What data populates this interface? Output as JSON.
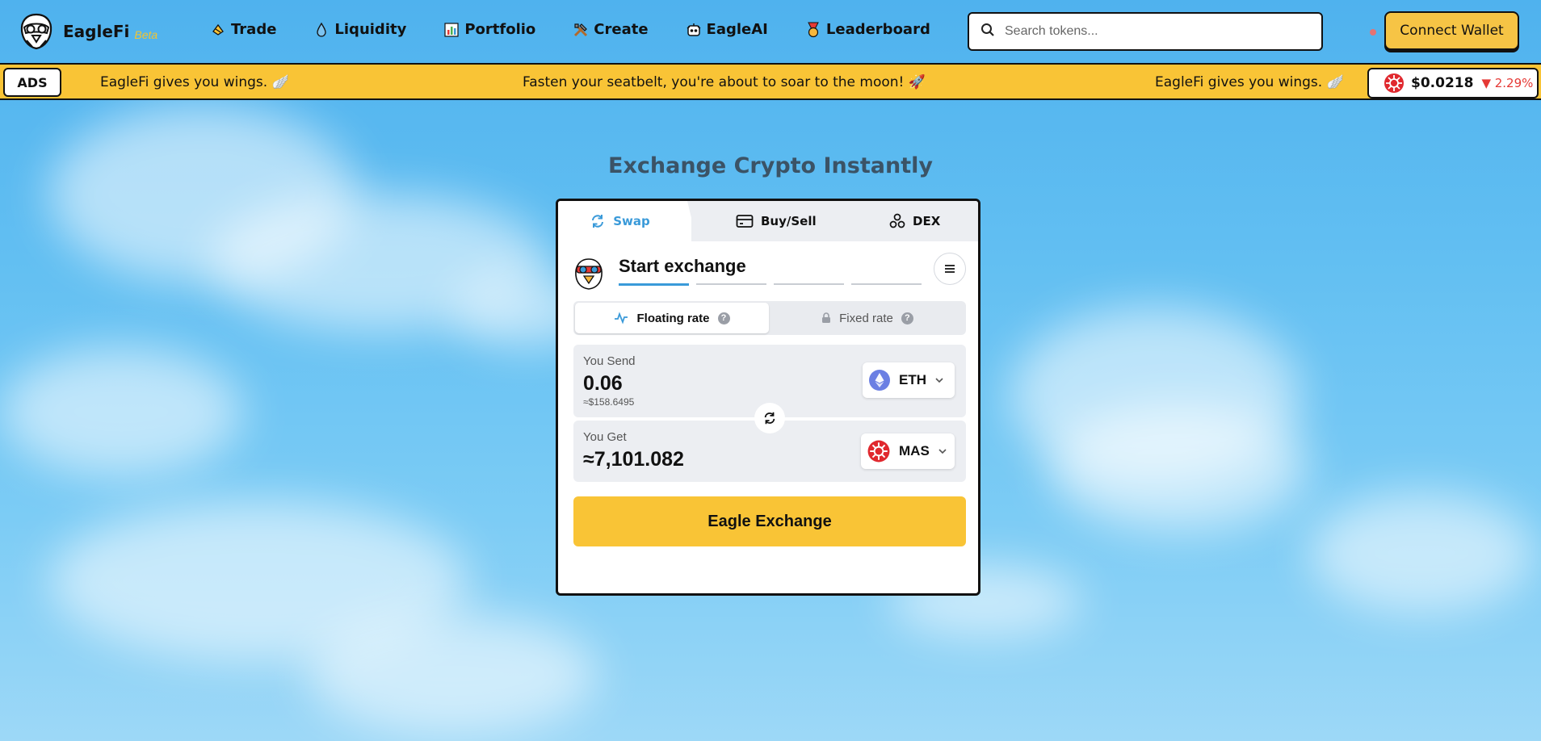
{
  "brand": {
    "name": "EagleFi",
    "beta": "Beta"
  },
  "nav": [
    {
      "label": "Trade",
      "icon": "trade-icon"
    },
    {
      "label": "Liquidity",
      "icon": "droplet-icon"
    },
    {
      "label": "Portfolio",
      "icon": "bar-chart-icon"
    },
    {
      "label": "Create",
      "icon": "tools-icon"
    },
    {
      "label": "EagleAI",
      "icon": "robot-icon"
    },
    {
      "label": "Leaderboard",
      "icon": "medal-icon"
    }
  ],
  "search": {
    "placeholder": "Search tokens..."
  },
  "connect_wallet": "Connect Wallet",
  "ticker": {
    "ads": "ADS",
    "messages": [
      "EagleFi gives you wings. 🪽",
      "Fasten your seatbelt, you're about to soar to the moon! 🚀",
      "EagleFi gives you wings. 🪽"
    ],
    "price": "$0.0218",
    "change": "▼ 2.29%"
  },
  "main": {
    "title": "Exchange Crypto Instantly"
  },
  "tabs": {
    "swap": "Swap",
    "buy_sell": "Buy/Sell",
    "dex": "DEX"
  },
  "exchange": {
    "title": "Start exchange",
    "rate_floating": "Floating rate",
    "rate_fixed": "Fixed rate",
    "help": "?",
    "send_label": "You Send",
    "send_amount": "0.06",
    "send_usd": "≈$158.6495",
    "send_token": "ETH",
    "get_label": "You Get",
    "get_amount": "≈7,101.082",
    "get_token": "MAS",
    "button": "Eagle Exchange"
  },
  "colors": {
    "accent_yellow": "#f9c436",
    "tab_active_blue": "#3a9ad9",
    "eth_purple": "#6b7fe3",
    "mas_red": "#e0282e",
    "change_red": "#e53935"
  }
}
